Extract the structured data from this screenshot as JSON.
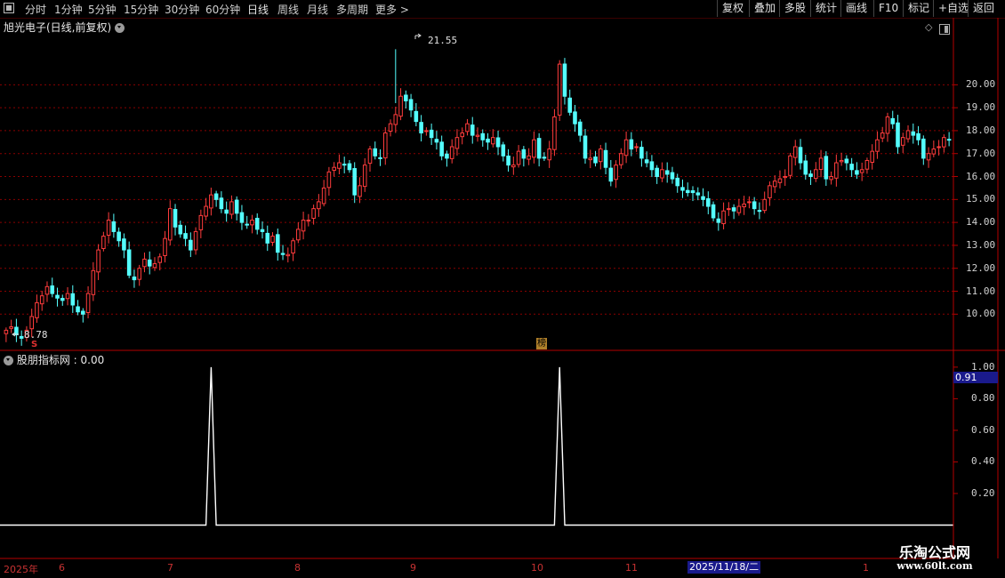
{
  "toolbar": {
    "periods": [
      "分时",
      "1分钟",
      "5分钟",
      "15分钟",
      "30分钟",
      "60分钟",
      "日线",
      "周线",
      "月线",
      "多周期",
      "更多 >"
    ],
    "buttons": [
      "复权",
      "叠加",
      "多股",
      "统计",
      "画线",
      "F10",
      "标记",
      "+自选",
      "返回"
    ]
  },
  "chart_title": "旭光电子(日线,前复权)",
  "indicator_title": "股朋指标网 : 0.00",
  "annotations": {
    "high": "21.55",
    "low": "8.78",
    "marker_s": "S",
    "marker_rank": "榜"
  },
  "current_indicator_value": "0.91",
  "cursor_date": "2025/11/18/二",
  "date_axis": [
    "2025年",
    "6",
    "7",
    "8",
    "9",
    "10",
    "11",
    "1"
  ],
  "watermark": {
    "line1": "乐淘公式网",
    "line2": "www.60lt.com"
  },
  "colors": {
    "up": "#ff3c3c",
    "down": "#54ffff",
    "grid": "#8a0000",
    "signal": "#ffffff",
    "axis": "#b40000"
  },
  "chart_data": [
    {
      "type": "candlestick",
      "title": "旭光电子(日线,前复权)",
      "y_ticks": [
        10.0,
        11.0,
        12.0,
        13.0,
        14.0,
        15.0,
        16.0,
        17.0,
        18.0,
        19.0,
        20.0
      ],
      "ylim": [
        8.5,
        22.3
      ],
      "high_label": 21.55,
      "low_label": 8.78,
      "close": [
        9.3,
        9.45,
        9.1,
        8.95,
        9.3,
        9.9,
        10.5,
        10.8,
        11.2,
        10.9,
        10.7,
        10.6,
        10.9,
        10.4,
        10.1,
        10.0,
        10.9,
        11.9,
        12.8,
        13.4,
        14.1,
        13.6,
        13.2,
        12.8,
        11.7,
        11.5,
        12.0,
        12.4,
        12.1,
        12.2,
        12.5,
        13.3,
        14.6,
        13.8,
        13.5,
        13.3,
        12.8,
        13.6,
        14.3,
        14.7,
        15.2,
        15.0,
        14.6,
        14.4,
        14.9,
        14.4,
        14.0,
        13.9,
        14.1,
        13.7,
        13.6,
        13.1,
        13.4,
        12.7,
        12.6,
        12.6,
        13.2,
        13.7,
        14.1,
        14.1,
        14.6,
        14.9,
        15.5,
        16.2,
        16.4,
        16.6,
        16.5,
        16.3,
        15.2,
        15.6,
        16.5,
        17.2,
        16.9,
        16.8,
        17.9,
        18.3,
        18.7,
        19.5,
        19.3,
        18.9,
        18.4,
        17.9,
        18.0,
        17.7,
        17.5,
        16.9,
        16.8,
        17.3,
        17.7,
        17.9,
        18.3,
        17.8,
        17.8,
        17.6,
        17.5,
        17.7,
        17.3,
        16.9,
        16.5,
        16.5,
        17.1,
        16.8,
        16.9,
        17.6,
        16.8,
        16.8,
        17.2,
        18.6,
        20.9,
        19.5,
        18.8,
        18.3,
        17.8,
        16.8,
        16.8,
        16.6,
        17.2,
        16.4,
        15.8,
        16.5,
        17.0,
        17.6,
        17.2,
        17.3,
        16.8,
        16.6,
        16.3,
        16.0,
        16.3,
        16.1,
        15.9,
        15.6,
        15.4,
        15.3,
        15.3,
        15.2,
        15.0,
        14.7,
        14.2,
        14.0,
        14.5,
        14.6,
        14.5,
        14.7,
        14.8,
        14.9,
        14.6,
        14.5,
        15.0,
        15.6,
        15.8,
        15.9,
        16.0,
        16.9,
        17.3,
        16.6,
        16.1,
        16.0,
        16.3,
        16.8,
        15.9,
        16.0,
        16.6,
        16.7,
        16.6,
        16.3,
        16.1,
        16.3,
        16.7,
        17.1,
        17.6,
        17.9,
        18.6,
        18.3,
        17.3,
        17.7,
        18.0,
        17.8,
        17.6,
        16.8,
        17.0,
        17.2,
        17.3,
        17.7,
        17.6
      ]
    },
    {
      "type": "line",
      "title": "股朋指标网",
      "y_ticks": [
        0.2,
        0.4,
        0.6,
        0.8,
        1.0
      ],
      "ylim": [
        -0.2,
        1.05
      ],
      "spikes": [
        {
          "index": 40,
          "value": 1.0
        },
        {
          "index": 108,
          "value": 1.0
        }
      ],
      "baseline": 0.0
    }
  ]
}
